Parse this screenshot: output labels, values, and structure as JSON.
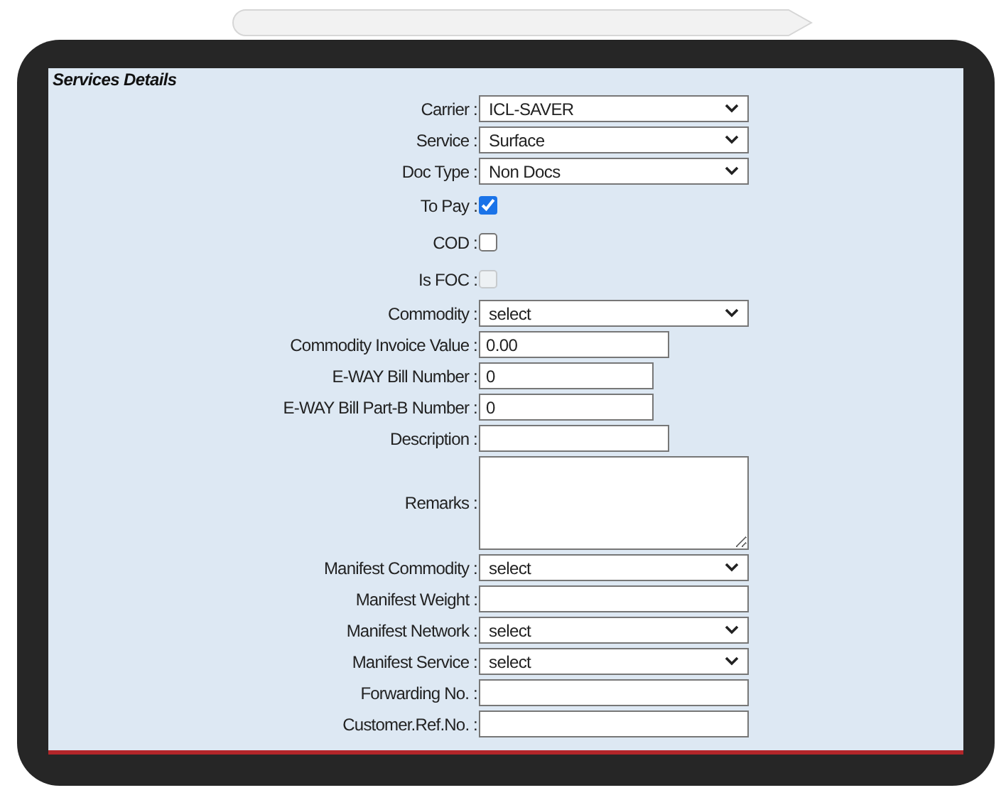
{
  "section_title": "Services Details",
  "fields": [
    {
      "label": "Carrier :",
      "kind": "select",
      "value": "ICL-SAVER"
    },
    {
      "label": "Service :",
      "kind": "select",
      "value": "Surface"
    },
    {
      "label": "Doc Type :",
      "kind": "select",
      "value": "Non Docs"
    },
    {
      "label": "To Pay :",
      "kind": "checkbox",
      "checked": true,
      "disabled": false
    },
    {
      "label": "COD :",
      "kind": "checkbox",
      "checked": false,
      "disabled": false
    },
    {
      "label": "Is FOC :",
      "kind": "checkbox",
      "checked": false,
      "disabled": true
    },
    {
      "label": "Commodity :",
      "kind": "select",
      "value": "select"
    },
    {
      "label": "Commodity Invoice Value :",
      "kind": "text",
      "value": "0.00"
    },
    {
      "label": "E-WAY Bill Number :",
      "kind": "short",
      "value": "0"
    },
    {
      "label": "E-WAY Bill Part-B Number :",
      "kind": "short",
      "value": "0"
    },
    {
      "label": "Description :",
      "kind": "text"
    },
    {
      "label": "Remarks :",
      "kind": "textarea"
    },
    {
      "label": "Manifest Commodity :",
      "kind": "select",
      "value": "select"
    },
    {
      "label": "Manifest Weight :",
      "kind": "wide"
    },
    {
      "label": "Manifest Network :",
      "kind": "select",
      "value": "select"
    },
    {
      "label": "Manifest Service :",
      "kind": "select",
      "value": "select"
    },
    {
      "label": "Forwarding No. :",
      "kind": "wide"
    },
    {
      "label": "Customer.Ref.No. :",
      "kind": "wide"
    }
  ]
}
